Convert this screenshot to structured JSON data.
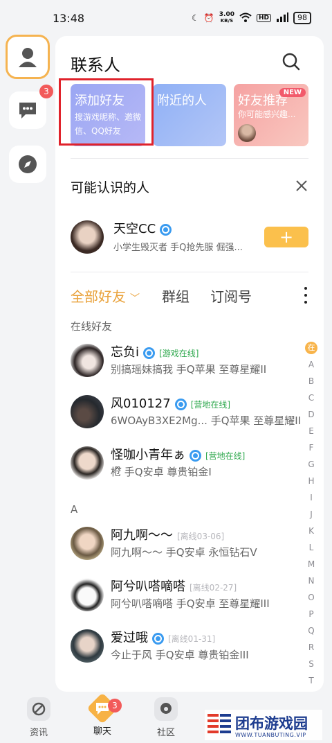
{
  "status_bar": {
    "time": "13:48",
    "net_speed": "3.00",
    "net_unit": "KB/S",
    "battery": "98"
  },
  "rail": {
    "chat_badge": "3"
  },
  "header": {
    "title": "联系人"
  },
  "cards": [
    {
      "title": "添加好友",
      "subtitle": "搜游戏昵称、邀微信、QQ好友"
    },
    {
      "title": "附近的人"
    },
    {
      "title": "好友推荐",
      "subtitle": "你可能感兴趣...",
      "tag": "NEW"
    }
  ],
  "suggest": {
    "title": "可能认识的人",
    "name": "天空CC",
    "desc": "小学生毁灭者 手Q抢先服 倔强...",
    "add_label": "+"
  },
  "tabs": [
    {
      "label": "全部好友"
    },
    {
      "label": "群组"
    },
    {
      "label": "订阅号"
    }
  ],
  "groups": {
    "online": "在线好友",
    "a": "A"
  },
  "friends": [
    {
      "name": "忘负i",
      "status": "[游戏在线]",
      "desc": "别搞瑶妹搞我  手Q苹果  至尊星耀II"
    },
    {
      "name": "风010127",
      "status": "[营地在线]",
      "desc": "6WOAyB3XE2Mg...  手Q苹果  至尊星耀II"
    },
    {
      "name": "怪咖小青年ぁ",
      "status": "[营地在线]",
      "desc": "枪໊  手Q安卓  尊贵铂金I"
    },
    {
      "name": "阿九啊～～",
      "status": "[离线03-06]",
      "desc": "阿九啊～～  手Q安卓  永恒钻石V"
    },
    {
      "name": "阿兮叭嗒嘀嗒",
      "status": "[离线02-27]",
      "desc": "阿兮叭嗒嘀嗒  手Q安卓  至尊星耀III"
    },
    {
      "name": "爱过哦",
      "status": "[离线01-31]",
      "desc": "今止于风  手Q安卓  尊贵铂金III"
    }
  ],
  "alphabet": [
    "在",
    "A",
    "B",
    "C",
    "D",
    "E",
    "F",
    "G",
    "H",
    "I",
    "J",
    "K",
    "L",
    "M",
    "N",
    "O",
    "P",
    "Q",
    "R",
    "S",
    "T"
  ],
  "bottom_nav": [
    {
      "label": "资讯"
    },
    {
      "label": "聊天",
      "badge": "3"
    },
    {
      "label": "社区"
    }
  ],
  "watermark": {
    "text": "团布游戏园",
    "url": "WWW.TUANBUTING.VIP"
  },
  "colors": {
    "accent": "#F7B245",
    "online": "#2EA84D",
    "badge": "#F25A5A",
    "highlight": "#E0222B"
  }
}
